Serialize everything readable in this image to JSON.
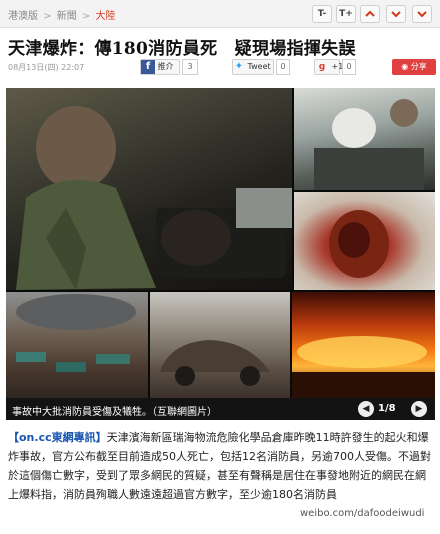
{
  "breadcrumb": {
    "items": [
      "港澳版",
      "新聞",
      "大陸"
    ],
    "separator": ">"
  },
  "toolbar": {
    "font_smaller": "T-",
    "font_larger": "T+"
  },
  "headline": "天津爆炸：傳180消防員死　疑現場指揮失誤",
  "meta": {
    "date": "08月13日(四) 22:07"
  },
  "share": {
    "facebook_label": "推介",
    "facebook_count": "3",
    "twitter_label": "Tweet",
    "twitter_count": "0",
    "gplus_label": "+1",
    "gplus_count": "0",
    "weibo_label": "分享"
  },
  "gallery": {
    "caption": "事故中大批消防員受傷及犧牲。（互聯網圖片）",
    "page_indicator": "1/8"
  },
  "article": {
    "source": "【on.cc東網專訊】",
    "body": "天津濱海新區瑞海物流危險化學品倉庫昨晚11時許發生的起火和爆炸事故，官方公布截至目前造成50人死亡，包括12名消防員，另逾700人受傷。不過對於這個傷亡數字，受到了眾多網民的質疑，甚至有聲稱是居住在事發地附近的網民在網上爆料指，消防員殉職人數遠遠超過官方數字，至少逾180名消防員"
  },
  "watermark": "weibo.com/dafoodeiwudi",
  "colors": {
    "accent": "#d23a1c",
    "facebook": "#3b5998",
    "weibo": "#e04040",
    "source_link": "#1a56b0"
  },
  "icons": [
    "chevron-up-icon",
    "chevron-down-icon",
    "facebook-icon",
    "twitter-icon",
    "gplus-icon",
    "weibo-icon",
    "arrow-left-icon",
    "arrow-right-icon"
  ]
}
